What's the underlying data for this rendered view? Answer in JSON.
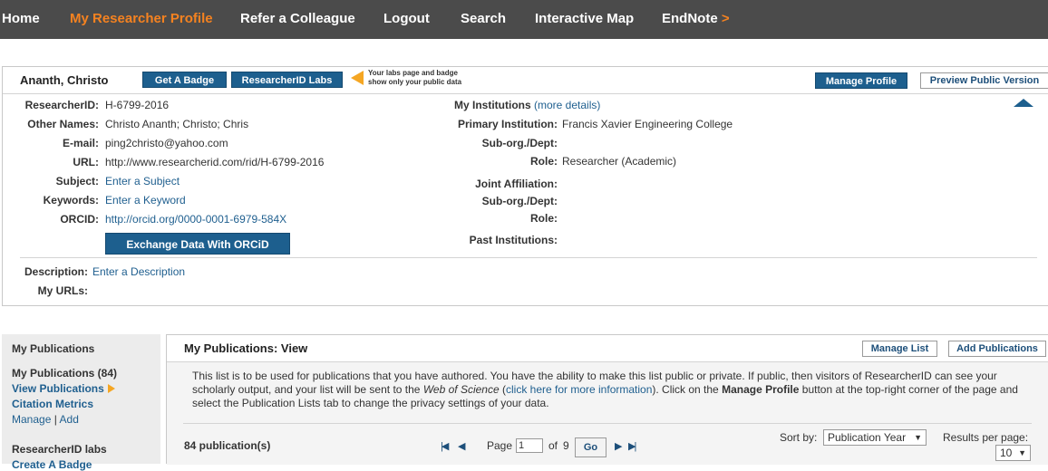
{
  "nav": {
    "home": "Home",
    "my_profile": "My Researcher Profile",
    "refer": "Refer a Colleague",
    "logout": "Logout",
    "search": "Search",
    "map": "Interactive Map",
    "endnote": "EndNote",
    "endnote_arrow": ">"
  },
  "profile": {
    "name": "Ananth, Christo",
    "get_badge": "Get A Badge",
    "labs": "ResearcherID Labs",
    "labs_note_line1": "Your labs page and badge",
    "labs_note_line2": "show only your public data",
    "manage_profile": "Manage Profile",
    "preview_public": "Preview Public Version",
    "fields": {
      "rid_label": "ResearcherID:",
      "rid_value": "H-6799-2016",
      "other_names_label": "Other Names:",
      "other_names_value": "Christo Ananth; Christo; Chris",
      "email_label": "E-mail:",
      "email_value": "ping2christo@yahoo.com",
      "url_label": "URL:",
      "url_value": "http://www.researcherid.com/rid/H-6799-2016",
      "subject_label": "Subject:",
      "subject_value": "Enter a Subject",
      "keywords_label": "Keywords:",
      "keywords_value": "Enter a Keyword",
      "orcid_label": "ORCID:",
      "orcid_value": "http://orcid.org/0000-0001-6979-584X",
      "orcid_button": "Exchange Data With ORCiD",
      "description_label": "Description:",
      "description_value": "Enter a Description",
      "my_urls_label": "My URLs:"
    },
    "institutions": {
      "heading": "My Institutions",
      "more_details": "(more details)",
      "primary_label": "Primary Institution:",
      "primary_value": "Francis Xavier Engineering College",
      "suborg_label": "Sub-org./Dept:",
      "role_label": "Role:",
      "role_value": "Researcher (Academic)",
      "joint_label": "Joint Affiliation:",
      "suborg2_label": "Sub-org./Dept:",
      "role2_label": "Role:",
      "past_label": "Past Institutions:"
    }
  },
  "sidebar": {
    "section1": "My Publications",
    "my_pubs": "My Publications (84)",
    "view_pubs": "View Publications",
    "citation": "Citation Metrics",
    "manage": "Manage",
    "sep": "|",
    "add": "Add",
    "section2": "ResearcherID labs",
    "create_badge": "Create A Badge"
  },
  "publications": {
    "title": "My Publications: View",
    "manage_list": "Manage List",
    "add_pubs": "Add Publications",
    "notice_part1": "This list is to be used for publications that you have authored. You have the ability to make this list public or private. If public, then visitors of ResearcherID can see your scholarly output, and your list will be sent to the ",
    "notice_wos": "Web of Science",
    "notice_part2": " (",
    "notice_link": "click here for more information",
    "notice_part3": "). Click on the ",
    "notice_manage": "Manage Profile",
    "notice_part4": " button at the top-right corner of the page and select the Publication Lists tab to change the privacy settings of your data.",
    "count": "84 publication(s)",
    "page_label": "Page",
    "page_value": "1",
    "of_label": "of",
    "total_pages": "9",
    "go": "Go",
    "sort_label": "Sort by:",
    "sort_value": "Publication Year",
    "rpp_label": "Results per page:",
    "rpp_value": "10"
  }
}
